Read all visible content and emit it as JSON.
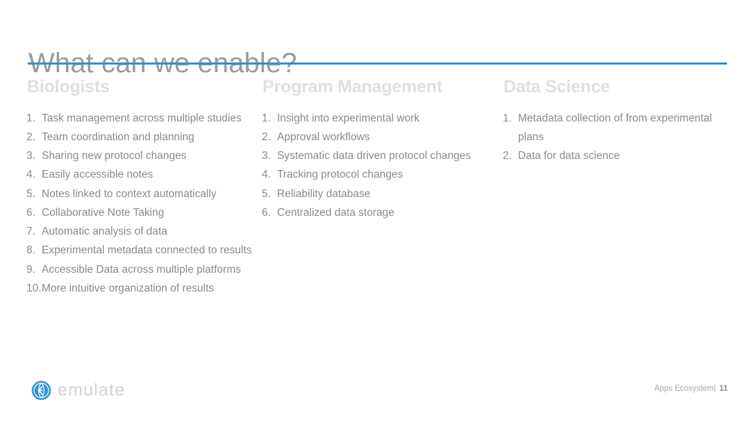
{
  "slide": {
    "title": "What can we enable?",
    "accent_color": "#2b90d9",
    "title_color": "#9b9b9b",
    "header_color": "#dfdfdf",
    "body_color": "#8a8a8a",
    "background_color": "#ffffff"
  },
  "columns": [
    {
      "header": "Biologists",
      "items": [
        {
          "num": "1.",
          "text": "Task management across multiple studies"
        },
        {
          "num": "2.",
          "text": "Team coordination and planning"
        },
        {
          "num": "3.",
          "text": "Sharing new protocol changes"
        },
        {
          "num": "4.",
          "text": "Easily accessible notes"
        },
        {
          "num": "5.",
          "text": "Notes linked to context automatically"
        },
        {
          "num": "6.",
          "text": "Collaborative Note Taking"
        },
        {
          "num": "7.",
          "text": "Automatic analysis of data"
        },
        {
          "num": "8.",
          "text": "Experimental metadata connected to results"
        },
        {
          "num": "9.",
          "text": "Accessible Data across multiple platforms"
        },
        {
          "num": "10.",
          "text": "More intuitive organization of results"
        }
      ]
    },
    {
      "header": "Program Management",
      "items": [
        {
          "num": "1.",
          "text": "Insight into experimental work"
        },
        {
          "num": "2.",
          "text": "Approval workflows"
        },
        {
          "num": "3.",
          "text": "Systematic data driven protocol changes"
        },
        {
          "num": "4.",
          "text": "Tracking protocol changes"
        },
        {
          "num": "5.",
          "text": "Reliability database"
        },
        {
          "num": "6.",
          "text": "Centralized data storage"
        }
      ]
    },
    {
      "header": "Data Science",
      "items": [
        {
          "num": "1.",
          "text": "Metadata collection of from experimental plans"
        },
        {
          "num": "2.",
          "text": "Data for data science"
        }
      ]
    }
  ],
  "footer": {
    "logo_icon": "emulate-circle-logo-icon",
    "logo_word": "emulate",
    "logo_color": "#2b90d9",
    "deck_label": "Apps Ecosystem|",
    "page_number": "11"
  }
}
